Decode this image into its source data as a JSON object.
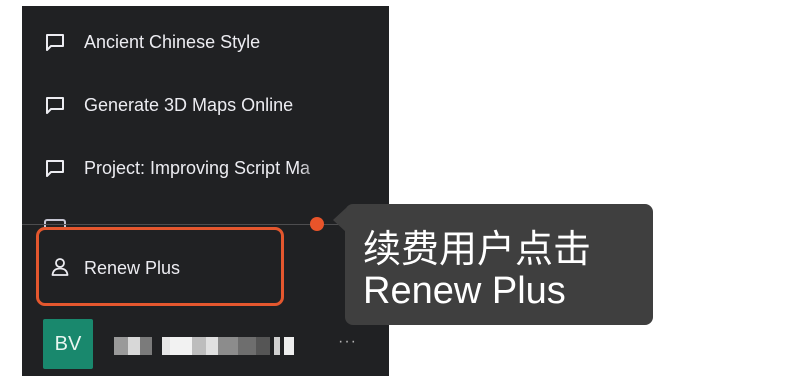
{
  "sidebar": {
    "chats": [
      {
        "label": "Ancient Chinese Style",
        "icon": "chat-bubble-icon"
      },
      {
        "label": "Generate 3D Maps Online",
        "icon": "chat-bubble-icon"
      },
      {
        "label": "Project: Improving Script Ma",
        "icon": "chat-bubble-icon"
      }
    ],
    "renew": {
      "label": "Renew Plus",
      "icon": "user-icon",
      "highlight_color": "#e4572e"
    },
    "account": {
      "avatar_initials": "BV",
      "avatar_color": "#19886d",
      "more_label": "···"
    }
  },
  "tooltip": {
    "line1": "续费用户点击",
    "line2": "Renew Plus",
    "marker_color": "#e8542a"
  }
}
